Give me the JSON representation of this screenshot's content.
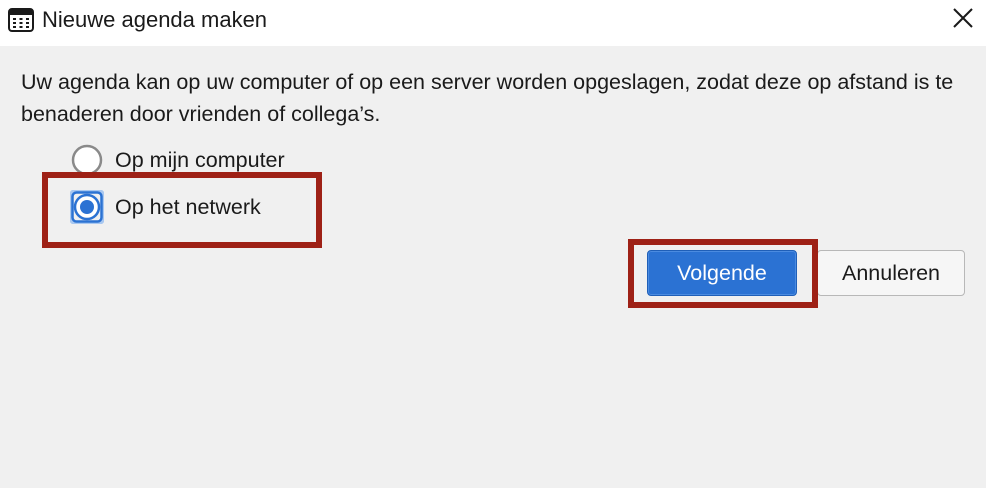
{
  "window": {
    "title": "Nieuwe agenda maken",
    "icon": "calendar-icon",
    "close_icon": "close-icon"
  },
  "dialog": {
    "description": "Uw agenda kan op uw computer of op een server worden opgeslagen, zodat deze op afstand is te benaderen door vrienden of collega’s.",
    "options": [
      {
        "label": "Op mijn computer",
        "selected": false
      },
      {
        "label": "Op het netwerk",
        "selected": true
      }
    ]
  },
  "buttons": {
    "next_label": "Volgende",
    "cancel_label": "Annuleren"
  },
  "colors": {
    "accent": "#2b72d3",
    "highlight": "#9e2116",
    "background": "#f0f0f0"
  }
}
